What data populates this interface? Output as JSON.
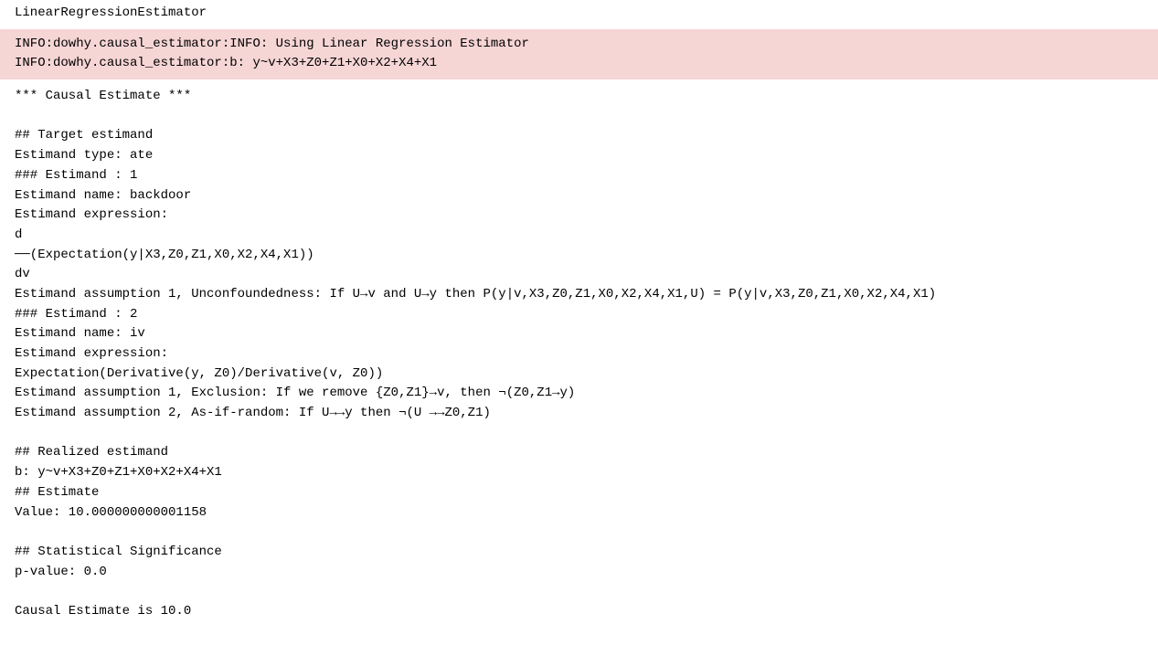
{
  "title": "LinearRegressionEstimator",
  "info_lines": "INFO:dowhy.causal_estimator:INFO: Using Linear Regression Estimator\nINFO:dowhy.causal_estimator:b: y~v+X3+Z0+Z1+X0+X2+X4+X1",
  "output": "*** Causal Estimate ***\n\n## Target estimand\nEstimand type: ate\n### Estimand : 1\nEstimand name: backdoor\nEstimand expression:\nd\n──(Expectation(y|X3,Z0,Z1,X0,X2,X4,X1))\ndv\nEstimand assumption 1, Unconfoundedness: If U→v and U→y then P(y|v,X3,Z0,Z1,X0,X2,X4,X1,U) = P(y|v,X3,Z0,Z1,X0,X2,X4,X1)\n### Estimand : 2\nEstimand name: iv\nEstimand expression:\nExpectation(Derivative(y, Z0)/Derivative(v, Z0))\nEstimand assumption 1, Exclusion: If we remove {Z0,Z1}→v, then ¬(Z0,Z1→y)\nEstimand assumption 2, As-if-random: If U→→y then ¬(U →→Z0,Z1)\n\n## Realized estimand\nb: y~v+X3+Z0+Z1+X0+X2+X4+X1\n## Estimate\nValue: 10.000000000001158\n\n## Statistical Significance\np-value: 0.0\n\nCausal Estimate is 10.0"
}
